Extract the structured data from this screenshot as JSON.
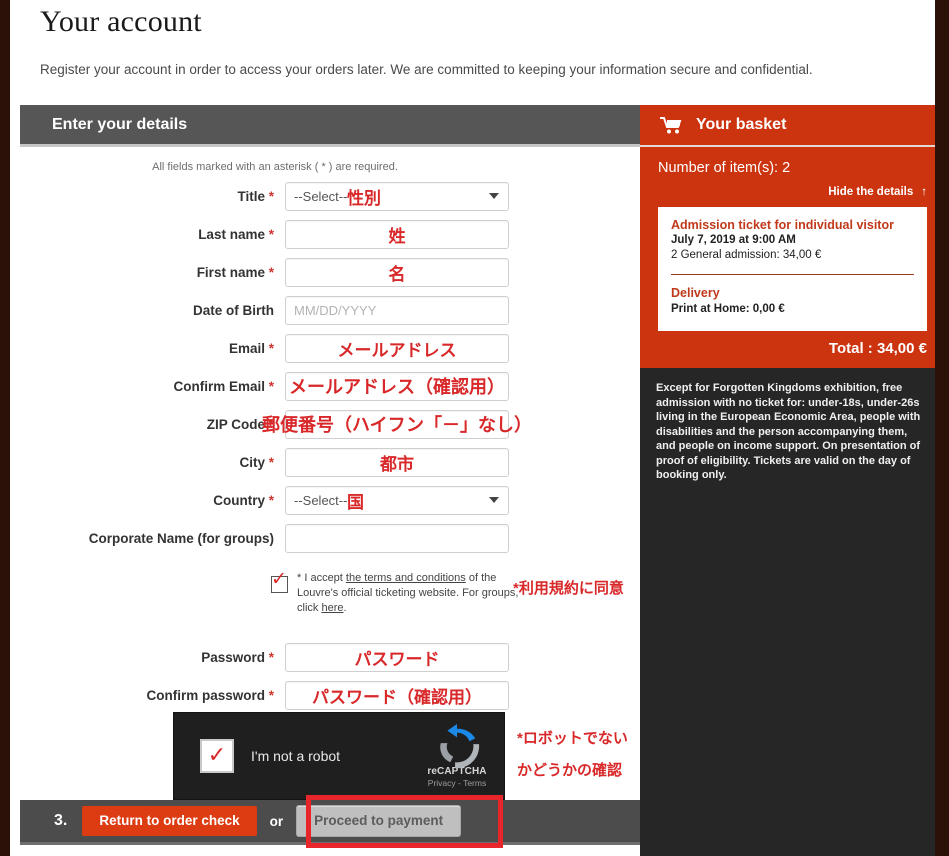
{
  "intro": {
    "title": "Your account",
    "description": "Register your account in order to access your orders later. We are committed to keeping your information secure and confidential."
  },
  "form_section": {
    "header": "Enter your details",
    "required_note": "All fields marked with an asterisk ( * ) are required.",
    "fields": [
      {
        "label": "Title",
        "required": "*",
        "type": "select",
        "value": "--Select--",
        "annotation": "性別"
      },
      {
        "label": "Last name",
        "required": "*",
        "type": "text",
        "value": "",
        "annotation": "姓"
      },
      {
        "label": "First name",
        "required": "*",
        "type": "text",
        "value": "",
        "annotation": "名"
      },
      {
        "label": "Date of Birth",
        "required": "",
        "type": "text",
        "placeholder": "MM/DD/YYYY",
        "value": "",
        "annotation": ""
      },
      {
        "label": "Email",
        "required": "*",
        "type": "text",
        "value": "",
        "annotation": "メールアドレス"
      },
      {
        "label": "Confirm Email",
        "required": "*",
        "type": "text",
        "value": "",
        "annotation": "メールアドレス（確認用）"
      },
      {
        "label": "ZIP Code",
        "required": "*",
        "type": "text",
        "value": "",
        "annotation": "郵便番号（ハイフン「－」なし）"
      },
      {
        "label": "City",
        "required": "*",
        "type": "text",
        "value": "",
        "annotation": "都市"
      },
      {
        "label": "Country",
        "required": "*",
        "type": "select",
        "value": "--Select--",
        "annotation": "国"
      },
      {
        "label": "Corporate Name (for groups)",
        "required": "",
        "type": "text",
        "value": "",
        "annotation": ""
      }
    ],
    "terms": {
      "checked": true,
      "text_1": "* I accept ",
      "link_1": "the terms and conditions",
      "text_2": " of the Louvre's official ticketing website. For groups, click ",
      "link_2": "here",
      "text_3": ".",
      "annotation": "*利用規約に同意"
    },
    "password_fields": [
      {
        "label": "Password",
        "required": "*",
        "type": "password",
        "value": "",
        "annotation": "パスワード"
      },
      {
        "label": "Confirm password",
        "required": "*",
        "type": "password",
        "value": "",
        "annotation": "パスワード（確認用）"
      }
    ],
    "recaptcha": {
      "checked": true,
      "label": "I'm not a robot",
      "brand": "reCAPTCHA",
      "legal": "Privacy - Terms",
      "annotation_line1": "*ロボットでない",
      "annotation_line2": "かどうかの確認"
    }
  },
  "action_bar": {
    "step": "3.",
    "return_label": "Return to order check",
    "or_label": "or",
    "proceed_label": "Proceed to payment"
  },
  "basket": {
    "title": "Your basket",
    "cart_icon": "cart-icon",
    "count_label": "Number of item(s): 2",
    "hide_details": "Hide the details",
    "hide_details_arrow": "↑",
    "item": {
      "title": "Admission ticket for individual visitor",
      "date": "July 7, 2019 at 9:00 AM",
      "detail": "2 General admission: 34,00 €"
    },
    "delivery": {
      "title": "Delivery",
      "detail": "Print at Home: 0,00 €"
    },
    "total": "Total : 34,00 €",
    "info_text": "Except for Forgotten Kingdoms exhibition, free admission with no ticket for: under-18s, under-26s living in the European Economic Area, people with disabilities and the person accompanying them, and people on income support. On presentation of proof of eligibility. Tickets are valid on the day of booking only."
  },
  "colors": {
    "brand_red": "#cc3410",
    "button_red": "#dd3c12",
    "annotation_red": "#d8282a",
    "header_gray": "#565656",
    "dark_panel": "#262626",
    "edge_strip": "#2b1208"
  }
}
